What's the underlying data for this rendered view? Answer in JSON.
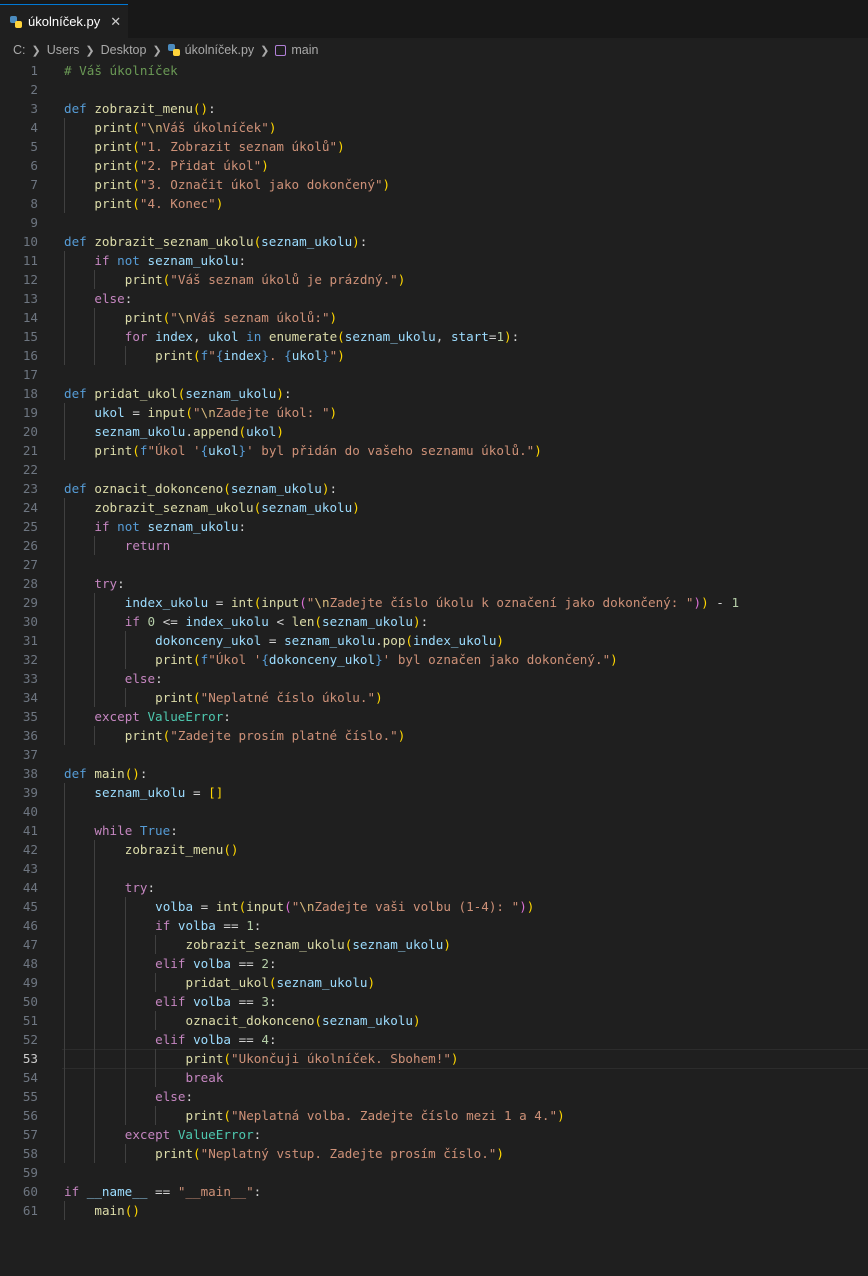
{
  "tab": {
    "label": "úkolníček.py",
    "close": "✕"
  },
  "breadcrumb": [
    "C:",
    "Users",
    "Desktop",
    "úkolníček.py",
    "main"
  ],
  "code_lines": [
    "# Váš úkolníček",
    "",
    "def zobrazit_menu():",
    "    print(\"\\nVáš úkolníček\")",
    "    print(\"1. Zobrazit seznam úkolů\")",
    "    print(\"2. Přidat úkol\")",
    "    print(\"3. Označit úkol jako dokončený\")",
    "    print(\"4. Konec\")",
    "",
    "def zobrazit_seznam_ukolu(seznam_ukolu):",
    "    if not seznam_ukolu:",
    "        print(\"Váš seznam úkolů je prázdný.\")",
    "    else:",
    "        print(\"\\nVáš seznam úkolů:\")",
    "        for index, ukol in enumerate(seznam_ukolu, start=1):",
    "            print(f\"{index}. {ukol}\")",
    "",
    "def pridat_ukol(seznam_ukolu):",
    "    ukol = input(\"\\nZadejte úkol: \")",
    "    seznam_ukolu.append(ukol)",
    "    print(f\"Úkol '{ukol}' byl přidán do vašeho seznamu úkolů.\")",
    "",
    "def oznacit_dokonceno(seznam_ukolu):",
    "    zobrazit_seznam_ukolu(seznam_ukolu)",
    "    if not seznam_ukolu:",
    "        return",
    "",
    "    try:",
    "        index_ukolu = int(input(\"\\nZadejte číslo úkolu k označení jako dokončený: \")) - 1",
    "        if 0 <= index_ukolu < len(seznam_ukolu):",
    "            dokonceny_ukol = seznam_ukolu.pop(index_ukolu)",
    "            print(f\"Úkol '{dokonceny_ukol}' byl označen jako dokončený.\")",
    "        else:",
    "            print(\"Neplatné číslo úkolu.\")",
    "    except ValueError:",
    "        print(\"Zadejte prosím platné číslo.\")",
    "",
    "def main():",
    "    seznam_ukolu = []",
    "",
    "    while True:",
    "        zobrazit_menu()",
    "",
    "        try:",
    "            volba = int(input(\"\\nZadejte vaši volbu (1-4): \"))",
    "            if volba == 1:",
    "                zobrazit_seznam_ukolu(seznam_ukolu)",
    "            elif volba == 2:",
    "                pridat_ukol(seznam_ukolu)",
    "            elif volba == 3:",
    "                oznacit_dokonceno(seznam_ukolu)",
    "            elif volba == 4:",
    "                print(\"Ukončuji úkolníček. Sbohem!\")",
    "                break",
    "            else:",
    "                print(\"Neplatná volba. Zadejte číslo mezi 1 a 4.\")",
    "        except ValueError:",
    "            print(\"Neplatný vstup. Zadejte prosím číslo.\")",
    "",
    "if __name__ == \"__main__\":",
    "    main()"
  ],
  "current_line": 53,
  "colors": {
    "editor_bg": "#1f1f1f",
    "tab_accent": "#0078d4",
    "keyword": "#569cd6",
    "control": "#c586c0",
    "function": "#dcdcaa",
    "string": "#ce9178",
    "comment": "#6a9955",
    "variable": "#9cdcfe",
    "number": "#b5cea8",
    "class": "#4ec9b0"
  },
  "icons": {
    "file": "python-file-icon",
    "symbol": "method-cube-icon",
    "separator": "chevron-right-icon"
  }
}
